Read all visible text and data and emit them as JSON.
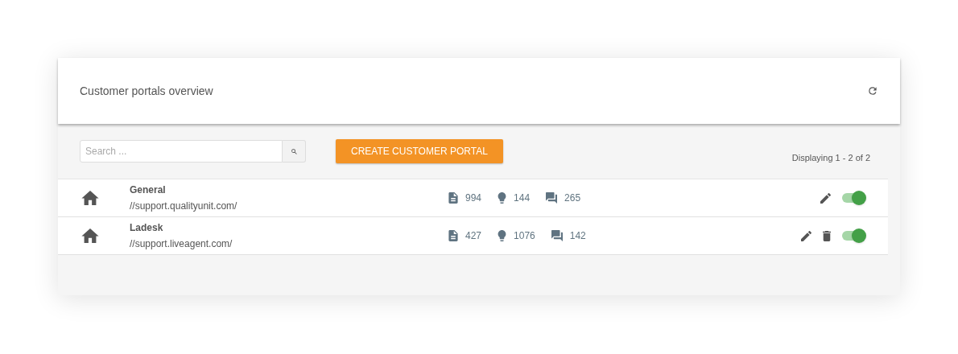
{
  "header": {
    "title": "Customer portals overview"
  },
  "toolbar": {
    "search": {
      "placeholder": "Search ..."
    },
    "create_button": "CREATE CUSTOMER PORTAL",
    "paging": "Displaying 1 - 2 of 2"
  },
  "portals": [
    {
      "name": "General",
      "url": "//support.qualityunit.com/",
      "stats": [
        {
          "kind": "articles",
          "value": "994"
        },
        {
          "kind": "ideas",
          "value": "144"
        },
        {
          "kind": "topics",
          "value": "265"
        }
      ],
      "deletable": false,
      "on": true
    },
    {
      "name": "Ladesk",
      "url": "//support.liveagent.com/",
      "stats": [
        {
          "kind": "articles",
          "value": "427"
        },
        {
          "kind": "ideas",
          "value": "1076"
        },
        {
          "kind": "topics",
          "value": "142"
        }
      ],
      "deletable": true,
      "on": true
    }
  ]
}
